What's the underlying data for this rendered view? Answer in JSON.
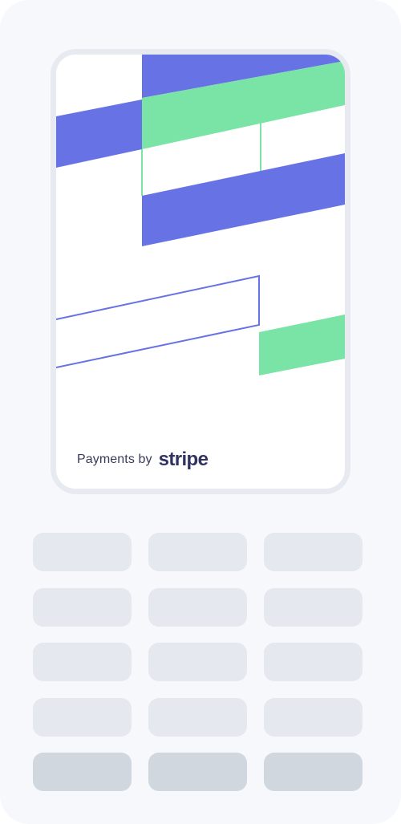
{
  "terminal": {
    "brand_text": "Payments by",
    "brand_logo": "stripe"
  },
  "colors": {
    "device_body": "#f6f8fb",
    "screen_frame": "#e7ebf1",
    "accent_purple": "#6772e5",
    "accent_green": "#7ae4a7",
    "key_light": "#e5e8ef",
    "key_dark": "#d0d7de"
  },
  "keypad": {
    "rows": 5,
    "columns": 3
  }
}
